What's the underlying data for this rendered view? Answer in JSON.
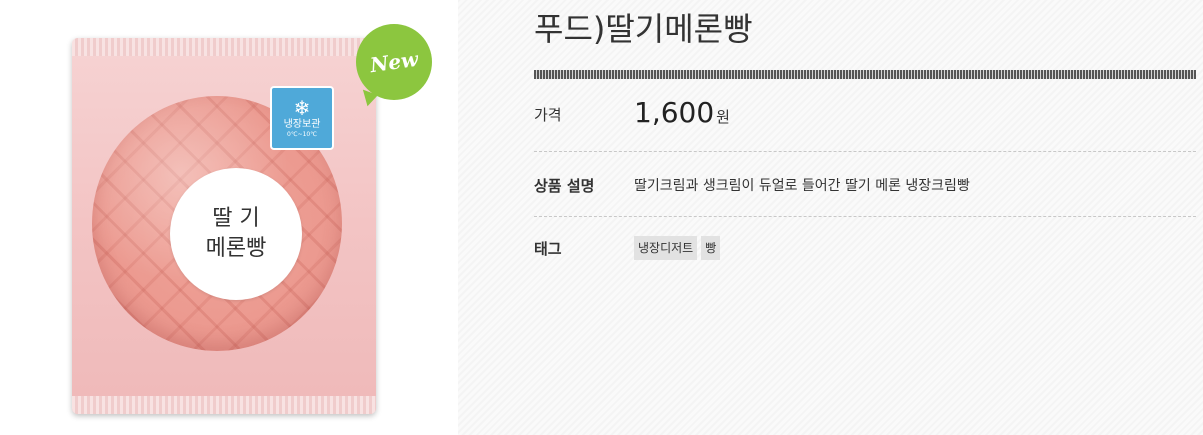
{
  "product_image": {
    "new_badge": "New",
    "cold_badge": {
      "icon": "snowflake-icon",
      "text": "냉장보관",
      "sub": "0℃~10℃"
    },
    "label_line1": "딸 기",
    "label_line2": "메론빵"
  },
  "product": {
    "title": "푸드)딸기메론빵",
    "price_label": "가격",
    "price_value": "1,600",
    "price_unit": "원",
    "desc_label": "상품 설명",
    "desc_text": "딸기크림과 생크림이 듀얼로 들어간 딸기 메론 냉장크림빵",
    "tags_label": "태그",
    "tags": [
      "냉장디저트",
      "빵"
    ]
  },
  "colors": {
    "new_badge": "#8cc63f",
    "cold_badge": "#4fa9d9",
    "package": "#f3c4c4"
  }
}
